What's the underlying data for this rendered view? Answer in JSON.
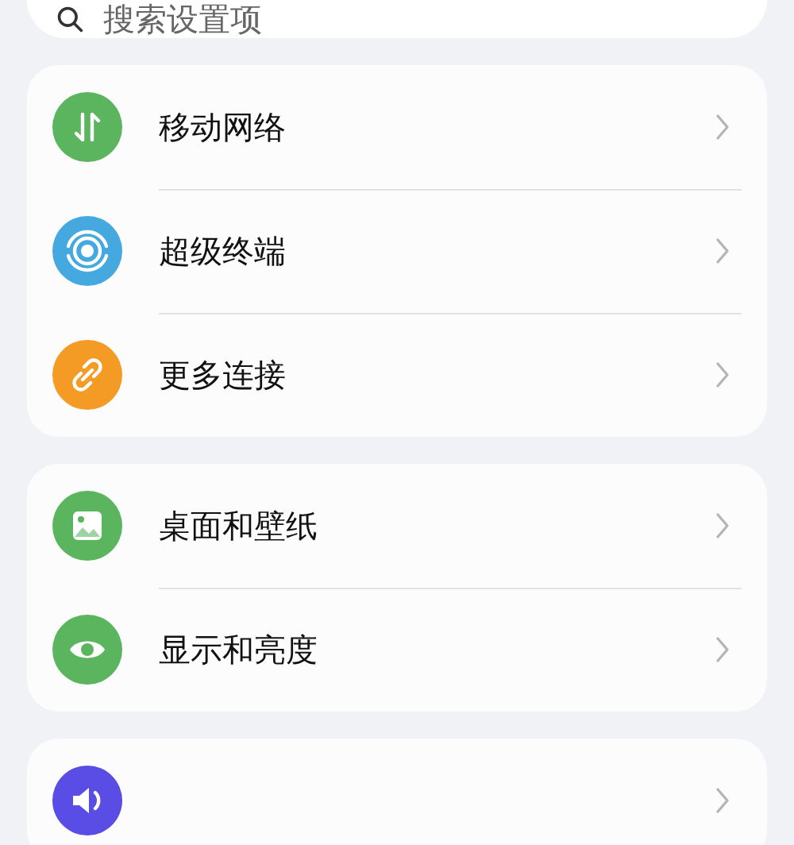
{
  "search": {
    "placeholder": "搜索设置项"
  },
  "groups": [
    {
      "items": [
        {
          "label": "移动网络",
          "kind": "network",
          "color": "#5bb55f"
        },
        {
          "label": "超级终端",
          "kind": "devices",
          "color": "#45a9e0"
        },
        {
          "label": "更多连接",
          "kind": "link",
          "color": "#f39b24"
        }
      ]
    },
    {
      "items": [
        {
          "label": "桌面和壁纸",
          "kind": "wallpaper",
          "color": "#5bb55f"
        },
        {
          "label": "显示和亮度",
          "kind": "display",
          "color": "#5bb55f"
        }
      ]
    },
    {
      "items": [
        {
          "kind": "sound",
          "color": "#5a4de6"
        }
      ]
    }
  ]
}
